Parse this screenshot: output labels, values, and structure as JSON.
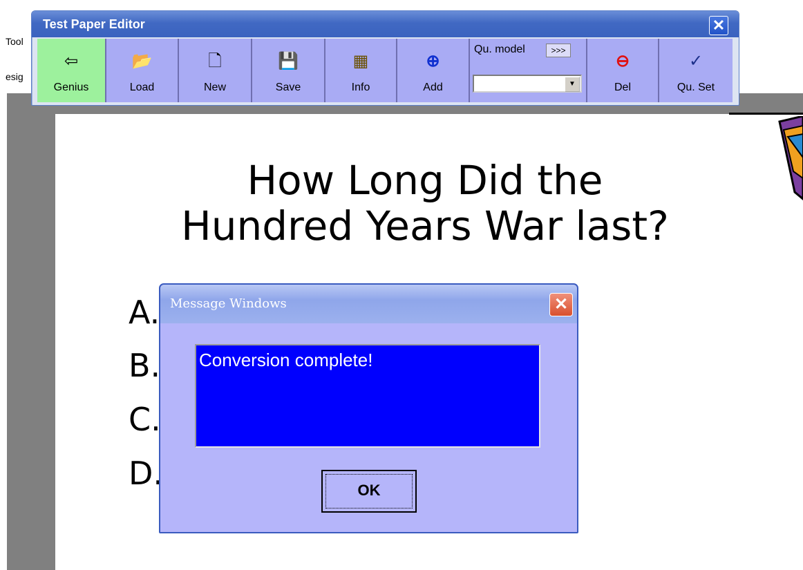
{
  "background": {
    "menu_items": [
      "Tool",
      "esig"
    ],
    "slide": {
      "title_line1": "How Long Did the",
      "title_line2": "Hundred Years War last?",
      "answers": [
        "A.",
        "B.",
        "C.",
        "D."
      ]
    }
  },
  "editor": {
    "title": "Test Paper Editor",
    "close_glyph": "✕",
    "toolbar": [
      {
        "label": "Genius",
        "icon": "arrow-left-icon",
        "glyph": "⇦",
        "active": true
      },
      {
        "label": "Load",
        "icon": "folder-open-icon",
        "glyph": "📂"
      },
      {
        "label": "New",
        "icon": "new-page-icon",
        "glyph": "🗋"
      },
      {
        "label": "Save",
        "icon": "floppy-disk-icon",
        "glyph": "💾"
      },
      {
        "label": "Info",
        "icon": "info-sheet-icon",
        "glyph": "▦"
      },
      {
        "label": "Add",
        "icon": "plus-circle-icon",
        "glyph": "⊕"
      },
      {
        "label": "Del",
        "icon": "minus-circle-icon",
        "glyph": "⊖"
      },
      {
        "label": "Qu. Set",
        "icon": "spellcheck-icon",
        "glyph": "✓"
      }
    ],
    "qu_model": {
      "label": "Qu. model",
      "more_label": ">>>",
      "selected": ""
    }
  },
  "dialog": {
    "title": "Message Windows",
    "close_glyph": "✕",
    "message": "Conversion complete!",
    "ok_label": "OK"
  },
  "colors": {
    "toolbar_bg": "#a9abf4",
    "active_button_bg": "#9df19d",
    "message_bg": "#0000fe",
    "dialog_bg": "#b5b5fa"
  }
}
